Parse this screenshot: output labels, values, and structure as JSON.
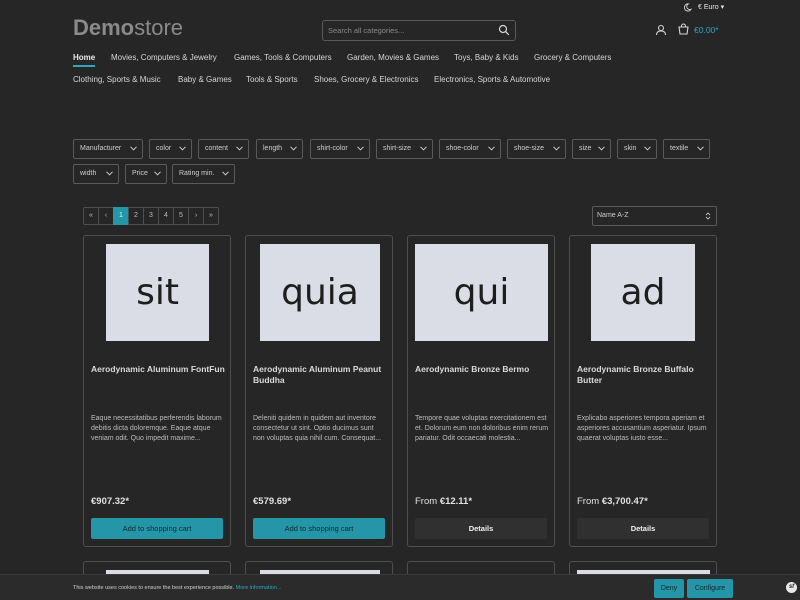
{
  "header": {
    "logo_bold": "Demo",
    "logo_light": "store",
    "search_placeholder": "Search all categories...",
    "currency": "€ Euro",
    "cart_total": "€0.00*"
  },
  "nav": {
    "row1": [
      "Home",
      "Movies, Computers & Jewelry",
      "Games, Tools & Computers",
      "Garden, Movies & Games",
      "Toys, Baby & Kids",
      "Grocery & Computers"
    ],
    "row2": [
      "Clothing, Sports & Music",
      "Baby & Games",
      "Tools & Sports",
      "Shoes, Grocery & Electronics",
      "Electronics, Sports & Automotive"
    ],
    "active": "Home"
  },
  "filters": {
    "row1": [
      "Manufacturer",
      "color",
      "content",
      "length",
      "shirt-color",
      "shirt-size",
      "shoe-color",
      "shoe-size",
      "size",
      "skin",
      "textile"
    ],
    "row2": [
      "width",
      "Price",
      "Rating min."
    ]
  },
  "pagination": {
    "first": "«",
    "prev": "‹",
    "pages": [
      "1",
      "2",
      "3",
      "4",
      "5"
    ],
    "next": "›",
    "last": "»",
    "current": "1"
  },
  "sort": {
    "selected": "Name A-Z"
  },
  "products": [
    {
      "image_text": "sit",
      "name": "Aerodynamic Aluminum FontFun",
      "description": "Eaque necessitatibus perferendis laborum debitis dicta doloremque. Eaque atque veniam odit. Quo impedit maxime...",
      "price_prefix": "",
      "price": "€907.32*",
      "button": "Add to shopping cart",
      "button_type": "buy"
    },
    {
      "image_text": "quia",
      "name": "Aerodynamic Aluminum Peanut Buddha",
      "description": "Deleniti quidem in quidem aut inventore consectetur ut sint. Optio ducimus sunt non voluptas quia nihil cum. Consequat...",
      "price_prefix": "",
      "price": "€579.69*",
      "button": "Add to shopping cart",
      "button_type": "buy"
    },
    {
      "image_text": "qui",
      "name": "Aerodynamic Bronze Bermo",
      "description": "Tempore quae voluptas exercitationem est et. Dolorum eum non doloribus enim rerum pariatur. Odit occaecati molestia...",
      "price_prefix": "From ",
      "price": "€12.11*",
      "button": "Details",
      "button_type": "details"
    },
    {
      "image_text": "ad",
      "name": "Aerodynamic Bronze Buffalo Butter",
      "description": "Explicabo asperiores tempora aperiam et asperiores accusantium asperiatur. Ipsum quaerat voluptas iusto esse...",
      "price_prefix": "From ",
      "price": "€3,700.47*",
      "button": "Details",
      "button_type": "details"
    }
  ],
  "cookie": {
    "text": "This website uses cookies to ensure the best experience possible.",
    "link": "More information...",
    "deny": "Deny",
    "configure": "Configure",
    "badge": "sf"
  },
  "colors": {
    "accent": "#2595a8",
    "background": "#262626",
    "image_bg": "#dadde6"
  },
  "icons": [
    "theme-toggle-icon",
    "search-icon",
    "user-icon",
    "cart-icon",
    "chevron-down-icon",
    "sort-updown-icon"
  ]
}
